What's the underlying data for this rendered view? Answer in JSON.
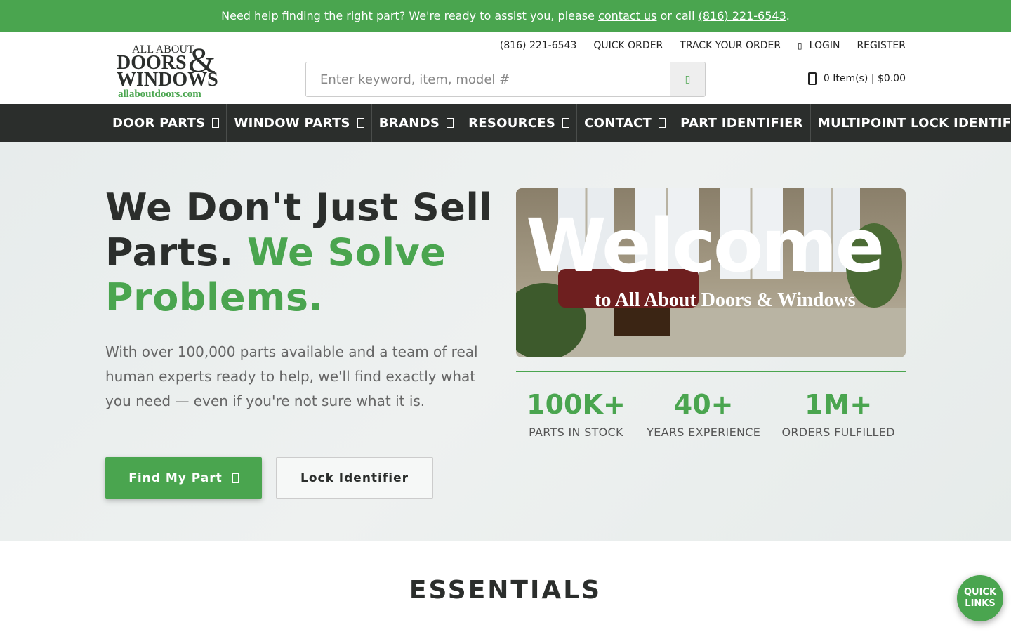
{
  "banner": {
    "text_before": "Need help finding the right part? We're ready to assist you, please ",
    "contact_link": "contact us",
    "text_middle": " or call ",
    "phone_link": "(816) 221-6543",
    "text_after": "."
  },
  "logo": {
    "line1": "ALL ABOUT",
    "line2": "DOORS",
    "amp": "&",
    "line3": "WINDOWS",
    "domain": "allaboutdoors.com"
  },
  "util_links": {
    "phone": "(816) 221-6543",
    "quick_order": "QUICK ORDER",
    "track_order": "TRACK YOUR ORDER",
    "login": "LOGIN",
    "register": "REGISTER"
  },
  "search": {
    "placeholder": "Enter keyword, item, model #",
    "icon": "search-icon"
  },
  "cart": {
    "label": "0 Item(s) | $0.00"
  },
  "nav": [
    {
      "label": "DOOR PARTS",
      "has_dropdown": true
    },
    {
      "label": "WINDOW PARTS",
      "has_dropdown": true
    },
    {
      "label": "BRANDS",
      "has_dropdown": true
    },
    {
      "label": "RESOURCES",
      "has_dropdown": true
    },
    {
      "label": "CONTACT",
      "has_dropdown": true
    },
    {
      "label": "PART IDENTIFIER",
      "has_dropdown": false
    },
    {
      "label": "MULTIPOINT LOCK IDENTIFIER",
      "has_dropdown": false
    }
  ],
  "hero": {
    "title_dark": "We Don't Just Sell Parts. ",
    "title_green": "We Solve Problems.",
    "text": "With over 100,000 parts available and a team of real human experts ready to help, we'll find exactly what you need — even if you're not sure what it is.",
    "primary_button": "Find My Part",
    "secondary_button": "Lock Identifier",
    "image_heading": "Welcome",
    "image_subheading": "to All About Doors & Windows"
  },
  "stats": [
    {
      "value": "100K+",
      "label": "PARTS IN STOCK"
    },
    {
      "value": "40+",
      "label": "YEARS EXPERIENCE"
    },
    {
      "value": "1M+",
      "label": "ORDERS FULFILLED"
    }
  ],
  "essentials": {
    "title": "ESSENTIALS"
  },
  "quick_links": {
    "line1": "QUICK",
    "line2": "LINKS"
  },
  "colors": {
    "brand_green": "#4aa54f",
    "nav_dark": "#2b2e2c"
  }
}
